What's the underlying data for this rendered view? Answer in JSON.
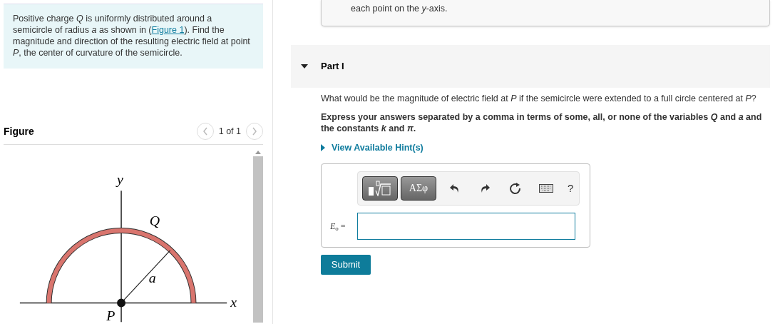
{
  "problem": {
    "before": "Positive charge *Q* is uniformly distributed around a semicircle of radius *a* as shown in (",
    "link": "Figure 1",
    "after": "). Find the magnitude and direction of the resulting electric field at point *P*, the center of curvature of the semicircle."
  },
  "figure": {
    "title": "Figure",
    "pager": "1 of 1",
    "prev_disabled": true,
    "next_disabled": true,
    "labels": {
      "y": "y",
      "q": "Q",
      "a": "a",
      "x": "x",
      "p": "P"
    }
  },
  "hint_box": {
    "text": "each point on the *y*-axis."
  },
  "part": {
    "title": "Part I",
    "expanded": true,
    "question": "What would be the magnitude of electric field at *P* if the semicircle were extended to a full circle centered at *P*?",
    "instruction": "Express your answers separated by a comma in terms of some, all, or none of the variables *Q* and *a* and the constants *k* and *π*.",
    "hints_link": "View Available Hint(s)",
    "toolbar": {
      "greek": "ΑΣφ",
      "help": "?"
    },
    "answer_label": "*E*$_{o}$ =",
    "submit": "Submit"
  }
}
